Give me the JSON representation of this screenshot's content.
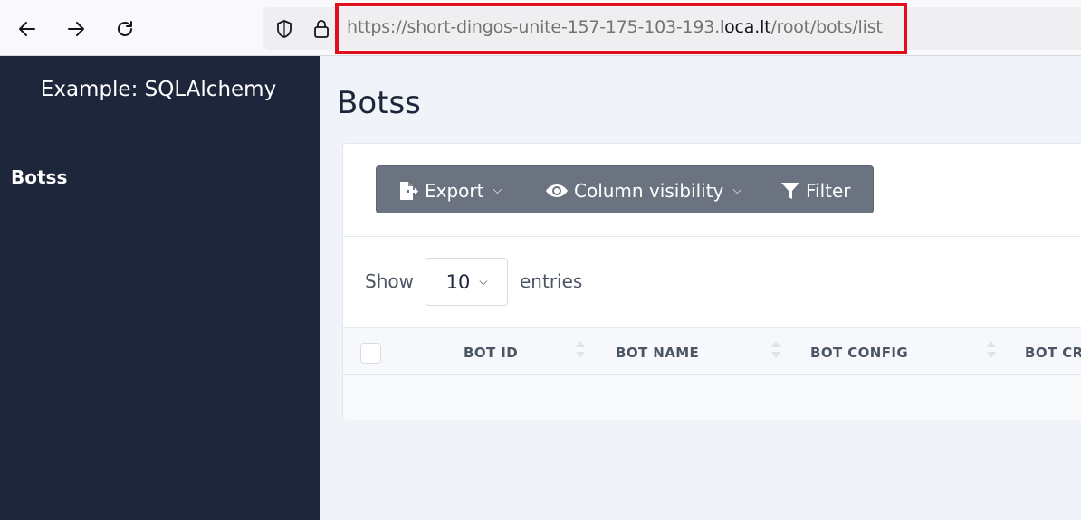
{
  "browser": {
    "url_prefix": "https://short-dingos-unite-157-175-103-193.",
    "url_domain": "loca.lt",
    "url_path": "/root/bots/list",
    "highlight_color": "#e10f1c"
  },
  "sidebar": {
    "brand": "Example: SQLAlchemy",
    "items": [
      {
        "label": "Botss"
      }
    ],
    "background": "#1d263b"
  },
  "main": {
    "title": "Botss",
    "toolbar": {
      "export_label": "Export",
      "column_visibility_label": "Column visibility",
      "filter_label": "Filter",
      "caret": "⌵"
    },
    "length": {
      "show_label": "Show",
      "value": "10",
      "entries_label": "entries"
    },
    "table": {
      "columns": [
        "BOT ID",
        "BOT NAME",
        "BOT CONFIG",
        "BOT CRE"
      ]
    }
  }
}
